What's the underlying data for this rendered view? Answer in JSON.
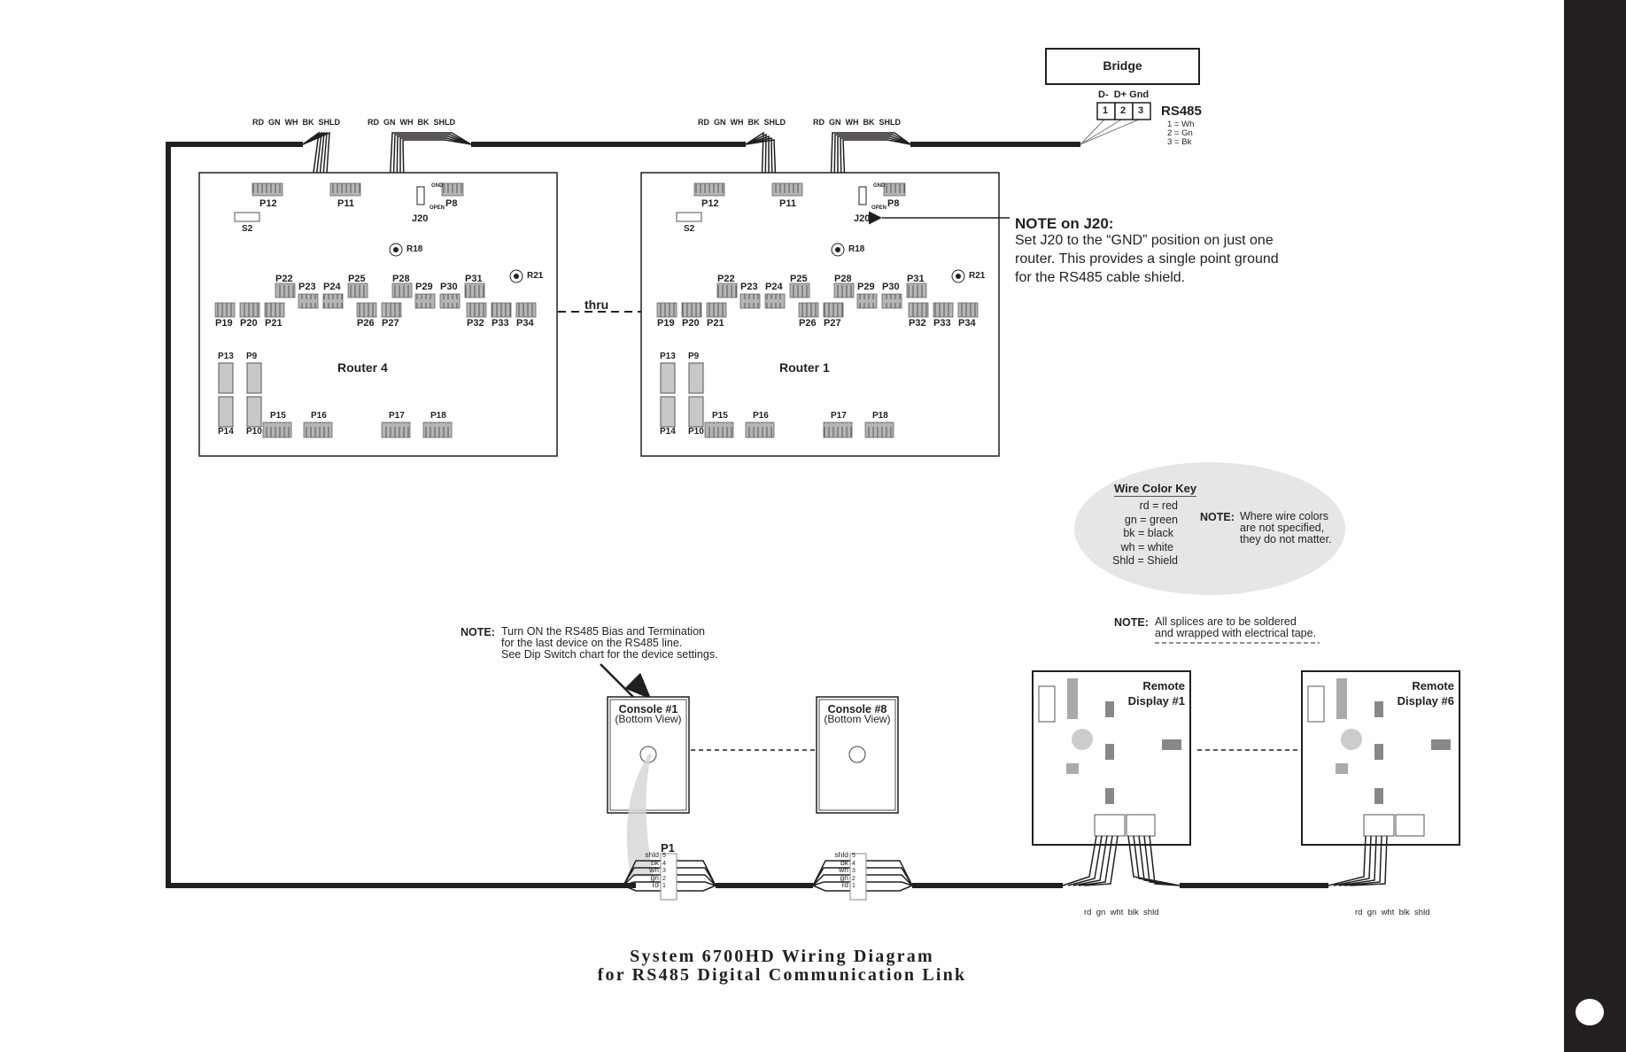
{
  "title": {
    "line1": "System 6700HD Wiring Diagram",
    "line2": "for RS485 Digital Communication Link"
  },
  "bridge": {
    "label": "Bridge",
    "terminal_header": "D-  D+ Gnd",
    "terminals": [
      "1",
      "2",
      "3"
    ],
    "bus_label": "RS485",
    "mapping": [
      "1 = Wh",
      "2 = Gn",
      "3 = Bk"
    ]
  },
  "wire_labels_upper": "RD  GN  WH  BK  SHLD",
  "wire_labels_lower": "rd  gn  wht  blk  shld",
  "routers": [
    {
      "name": "Router 4",
      "connectors_top": [
        "P12",
        "P11",
        "P8"
      ],
      "jumper": "J20",
      "jumper_positions": [
        "GND",
        "OPEN"
      ],
      "switch": "S2",
      "resistors": [
        "R18",
        "R21"
      ],
      "row_upper": [
        "P22",
        "P23",
        "P24",
        "P25",
        "P28",
        "P29",
        "P30",
        "P31"
      ],
      "row_lower": [
        "P19",
        "P20",
        "P21",
        "P26",
        "P27",
        "P32",
        "P33",
        "P34"
      ],
      "vertical": [
        "P13",
        "P9",
        "P14",
        "P10"
      ],
      "bottom": [
        "P15",
        "P16",
        "P17",
        "P18"
      ]
    },
    {
      "name": "Router 1",
      "connectors_top": [
        "P12",
        "P11",
        "P8"
      ],
      "jumper": "J20",
      "jumper_positions": [
        "GND",
        "OPEN"
      ],
      "switch": "S2",
      "resistors": [
        "R18",
        "R21"
      ],
      "row_upper": [
        "P22",
        "P23",
        "P24",
        "P25",
        "P28",
        "P29",
        "P30",
        "P31"
      ],
      "row_lower": [
        "P19",
        "P20",
        "P21",
        "P26",
        "P27",
        "P32",
        "P33",
        "P34"
      ],
      "vertical": [
        "P13",
        "P9",
        "P14",
        "P10"
      ],
      "bottom": [
        "P15",
        "P16",
        "P17",
        "P18"
      ]
    }
  ],
  "thru_label": "thru",
  "note_j20": {
    "heading": "NOTE on J20:",
    "lines": [
      "Set J20 to the “GND” position on just one",
      "router. This provides a single point ground",
      "for the RS485 cable shield."
    ]
  },
  "wire_key": {
    "heading": "Wire Color Key",
    "items": [
      "rd = red",
      "gn = green",
      "bk = black",
      "wh = white",
      "Shld = Shield"
    ],
    "note_label": "NOTE:",
    "note_lines": [
      "Where wire colors",
      "are not specified,",
      "they do not matter."
    ]
  },
  "note_termination": {
    "label": "NOTE:",
    "lines": [
      "Turn ON the RS485 Bias and Termination",
      "for the last device on the RS485 line.",
      "See Dip Switch chart for the device settings."
    ]
  },
  "note_splices": {
    "label": "NOTE:",
    "lines": [
      "All splices are to be soldered",
      "and wrapped with electrical tape."
    ]
  },
  "consoles": [
    {
      "name": "Console #1",
      "view": "(Bottom View)",
      "connector": "P1"
    },
    {
      "name": "Console #8",
      "view": "(Bottom View)",
      "connector": ""
    }
  ],
  "console_terminal_wires": [
    "shld",
    "bk",
    "wh",
    "gn",
    "rd"
  ],
  "console_terminal_numbers": [
    "5",
    "4",
    "3",
    "2",
    "1"
  ],
  "remote_displays": [
    {
      "line1": "Remote",
      "line2": "Display #1"
    },
    {
      "line1": "Remote",
      "line2": "Display #6"
    }
  ],
  "colors": {
    "ink": "#231f20",
    "board_gray": "#8c8c8c",
    "key_fill": "#e6e6e6",
    "side_bar": "#231f20"
  }
}
